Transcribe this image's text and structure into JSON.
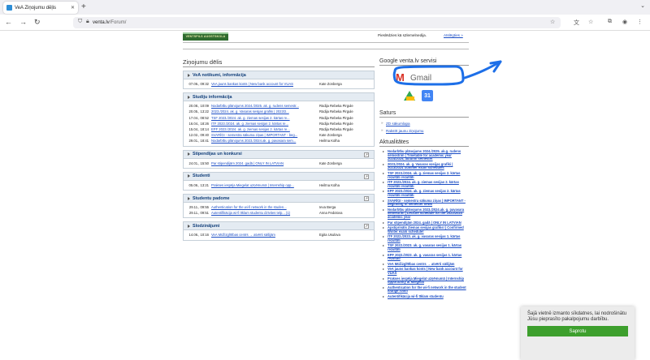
{
  "browser": {
    "tab_title": "VeA Ziņojumu dēļis",
    "new_tab_icon": "plus-icon",
    "url_host": "venta.lv",
    "url_path": "/Forum/"
  },
  "header": {
    "logo_text": "VENTSPILS AUGSTSKOLA",
    "logged_in_text": "Pieslēdzies kā s2lemelnedija.",
    "logout_label": "Atslēgties »"
  },
  "board": {
    "title": "Ziņojumu dēlis",
    "panels": [
      {
        "heading": "VeA notikumi, informācija",
        "rss": false,
        "rows": [
          {
            "date": "07.06., 09:32",
            "title": "VeA jauns bankas konts | New bank account for VUAS",
            "author": "Kate Zonberga"
          }
        ]
      },
      {
        "heading": "Studiju informācija",
        "rss": false,
        "rows": [
          {
            "date": "20.08., 10:09",
            "title": "Nodarbību plānojums 2024./2025. ak. g. rudens semestr...",
            "author": "Rūdija Rebeka Pirgule"
          },
          {
            "date": "20.05., 13:22",
            "title": "2023./2024. ak. g. Vasaras sesijas grafiki | 2023/2...",
            "author": "Rūdija Rebeka Pirgule"
          },
          {
            "date": "17.04., 08:52",
            "title": "TSF 2023./2024. ak. g. ziemas sesijas 2. kārtas re...",
            "author": "Rūdija Rebeka Pirgule"
          },
          {
            "date": "16.04., 18:26",
            "title": "ITF 2023./2024. ak. g. ziemas sesijas 2. kārtas re...",
            "author": "Rūdija Rebeka Pirgule"
          },
          {
            "date": "15.04., 18:14",
            "title": "EPF 2023./2024. ak. g. ziemas sesijas 2. kārtas re...",
            "author": "Rūdija Rebeka Pirgule"
          },
          {
            "date": "12.02., 09:40",
            "title": "SVARĪGI - semestra sākuma ziņas | IMPORTANT - beg...",
            "author": "Kate Zonberga"
          },
          {
            "date": "29.01., 18:41",
            "title": "Nodarbību plānojums 2023./2024.ak. g. pavasara sem...",
            "author": "Heilīna Kolha"
          }
        ]
      },
      {
        "heading": "Stipendijas un konkursi",
        "rss": true,
        "rows": [
          {
            "date": "24.01., 15:50",
            "title": "Par stipendijām 2024. gadā | ONLY IN LATVIAN",
            "author": "Kate Zonberga"
          }
        ]
      },
      {
        "heading": "Studenti",
        "rss": true,
        "rows": [
          {
            "date": "05.06., 13:21",
            "title": "Prakses iespēja Miegelat uzņēmumā | Internship opp...",
            "author": "Heilīna Kolha"
          }
        ]
      },
      {
        "heading": "Studentu padome",
        "rss": true,
        "rows": [
          {
            "date": "29.11., 09:55",
            "title": "Authentication for the wi-fi network in the studen...",
            "author": "Ieva Berga"
          },
          {
            "date": "29.11., 09:51",
            "title": "Autentifikācija wi-fi tīklam studentu dzīvites telp... (1)",
            "author": "Anna Fedotova"
          }
        ]
      },
      {
        "heading": "Slodzinājumi",
        "rss": true,
        "rows": [
          {
            "date": "14.06., 10:16",
            "title": "VeA Mūžizglītības centrs → atvērti sāšijām",
            "author": "Egita Usulova"
          }
        ]
      }
    ]
  },
  "sidebar": {
    "google_title": "Google venta.lv servisi",
    "gmail_label": "Gmail",
    "calendar_number": "31",
    "saturs_title": "Saturs",
    "saturs_items": [
      "ZD sākumlapa",
      "Rakstīt jaunu ziņojumu"
    ],
    "news_title": "Aktualitātes",
    "news_items": [
      "Nodarbību plānojums 2024./2025. ak.g. rudens semestrim | Timetable for academic year 2024/2025, autumn semester",
      "2023./2024. ak. g. Vasaras sesijas grafiki | 2023/2024 Summer exam schedules",
      "TSF 2023./2024. ak. g. ziemas sesijas 2. kārtas rezultāti rezultāti",
      "ITF 2023./2024. ak. g. ziemas sesijas 2. kārtas rezultāti rezultāti",
      "EPF 2023./2024. ak. g. ziemas sesijas 2. kārtas rezultāti rezultāti",
      "SVARĪGI - semestra sākuma ziņas | IMPORTANT - beginning of semester news",
      "Nodarbību plānojums 2023./2024.ak. g. pavasara semestrim | Lecture schedule for the 2023/2024 academic year",
      "Par stipendijām 2024. gadā | ONLY IN LATVIAN",
      "Apstiprināts Ziemas sesijas grafiks! | Confirmed Winter exam schedule!",
      "ITF 2022./2023. ak. g. vasaras sesijas 1. kārtas rezultāti",
      "TSF 2022./2023. ak. g. vasaras sesijas 1. kārtas rezultāti",
      "EPF 2022./2023. ak. g. vasaras sesijas 1. kārtas rezultāti",
      "VeA Mūžizglītības centrs → atvērti sāšijām",
      "VeA jauns bankas konts | New bank account for VUAS",
      "Prakses iespēja Miegelat uzņēmumā | Internship opportunity at Miegelat",
      "Authentication for the wi-fi network in the student lounge room",
      "Autentifikācija wi-fi tīklam studentu"
    ]
  },
  "cookie": {
    "message": "Šajā vietnē izmanto sīkdatnes, lai nodrošinātu Jūsu pieprasīto pakalpojumu darbību.",
    "button_label": "Saprotu"
  },
  "colors": {
    "link": "#1a4cc4",
    "panel_head_bg": "#e4ebf2",
    "cookie_button": "#3d9f2d",
    "annotation": "#1d6fe8"
  }
}
